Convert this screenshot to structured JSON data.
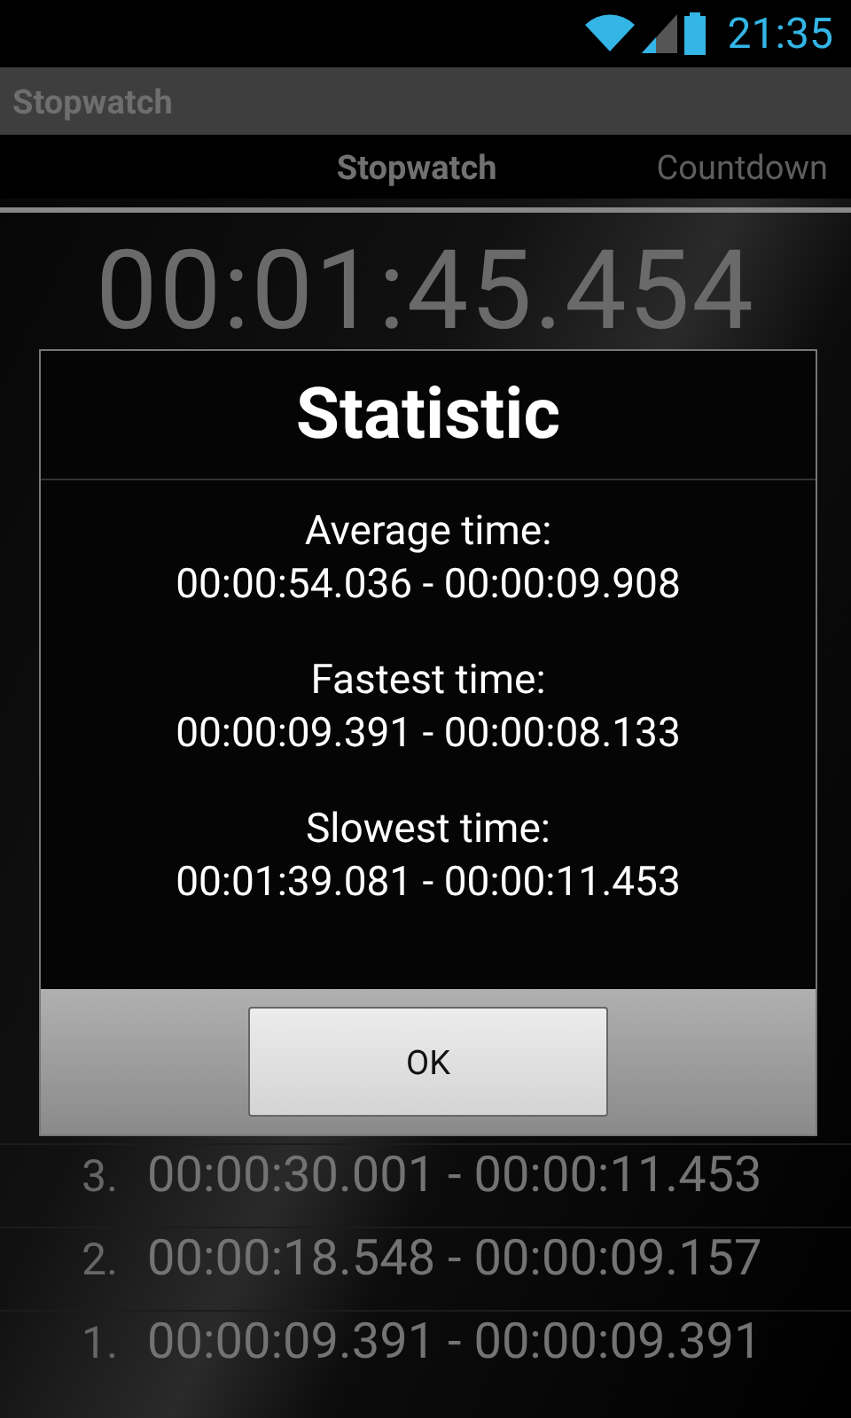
{
  "status_bar": {
    "time": "21:35"
  },
  "title_bar": {
    "title": "Stopwatch"
  },
  "tabs": [
    {
      "label": "Stopwatch",
      "selected": true
    },
    {
      "label": "Countdown",
      "selected": false
    }
  ],
  "timer": "00:01:45.454",
  "laps": [
    {
      "number": "3.",
      "time": "00:00:30.001 - 00:00:11.453"
    },
    {
      "number": "2.",
      "time": "00:00:18.548 - 00:00:09.157"
    },
    {
      "number": "1.",
      "time": "00:00:09.391 - 00:00:09.391"
    }
  ],
  "dialog": {
    "title": "Statistic",
    "stats": [
      {
        "label": "Average time:",
        "value": "00:00:54.036 - 00:00:09.908"
      },
      {
        "label": "Fastest time:",
        "value": "00:00:09.391 - 00:00:08.133"
      },
      {
        "label": "Slowest time:",
        "value": "00:01:39.081 - 00:00:11.453"
      }
    ],
    "buttons": [
      "OK"
    ]
  }
}
